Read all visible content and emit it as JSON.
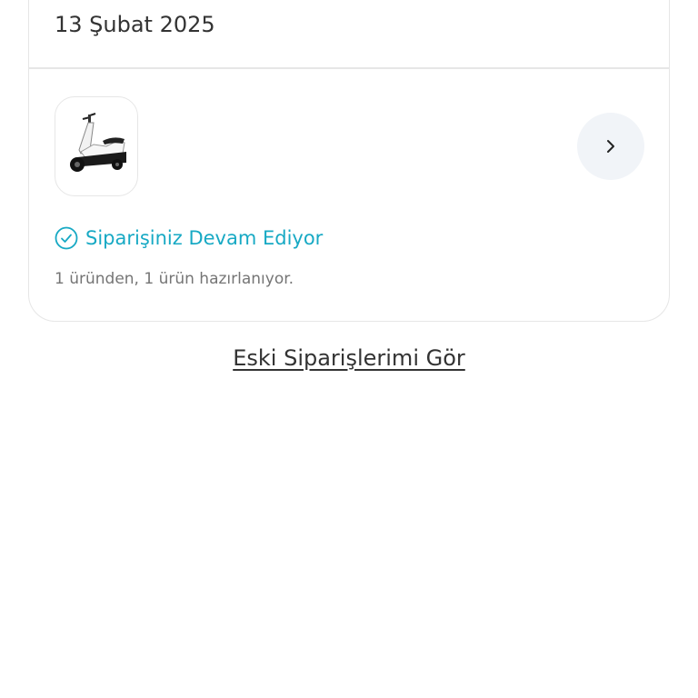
{
  "order": {
    "date": "13 Şubat 2025",
    "product_image_alt": "scooter",
    "details_icon": "chevron-right-icon",
    "status": {
      "icon": "check-circle-icon",
      "label": "Siparişiniz Devam Ediyor",
      "detail": "1 üründen, 1 ürün hazırlanıyor.",
      "color": "#17a9c4"
    }
  },
  "footer": {
    "old_orders_link": "Eski Siparişlerimi Gör"
  }
}
